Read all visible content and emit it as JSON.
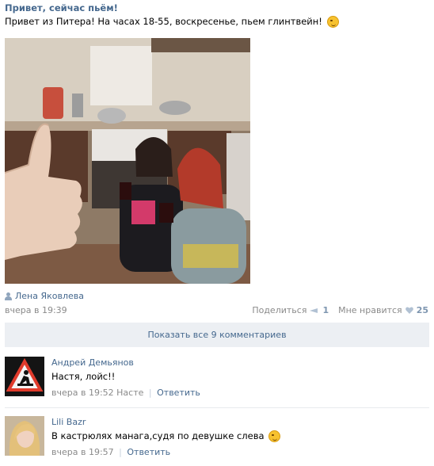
{
  "post": {
    "title": "Привет, сейчас пьём!",
    "text": "Привет из Питера! На часах 18-55, воскресенье, пьем глинтвейн!",
    "author": "Лена Яковлева",
    "date": "вчера в 19:39",
    "share_label": "Поделиться",
    "share_count": "1",
    "like_label": "Мне нравится",
    "like_count": "25"
  },
  "show_all_comments": "Показать все 9 комментариев",
  "comments": [
    {
      "name": "Андрей Демьянов",
      "text": "Настя, лойс!!",
      "date": "вчера в 19:52",
      "reply_to": "Насте",
      "reply_label": "Ответить"
    },
    {
      "name": "Lili Bazr",
      "text": "В кастрюлях манага,судя по девушке слева",
      "date": "вчера в 19:57",
      "reply_label": "Ответить"
    }
  ],
  "colors": {
    "link": "#45688e",
    "muted": "#8a8a8a",
    "panel": "#eceff3"
  }
}
